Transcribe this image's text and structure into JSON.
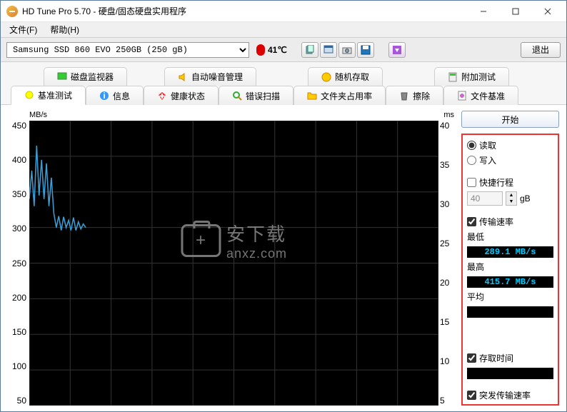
{
  "window_title": "HD Tune Pro 5.70 - 硬盘/固态硬盘实用程序",
  "menu": {
    "file": "文件(F)",
    "help": "帮助(H)"
  },
  "drive": "Samsung SSD 860 EVO 250GB (250 gB)",
  "temperature": "41℃",
  "exit_label": "退出",
  "tabs_row1": {
    "disk_monitor": "磁盘监视器",
    "auto_noise": "自动噪音管理",
    "random_access": "随机存取",
    "additional_test": "附加测试"
  },
  "tabs_row2": {
    "benchmark": "基准测试",
    "info": "信息",
    "health": "健康状态",
    "error_scan": "错误扫描",
    "folder_usage": "文件夹占用率",
    "erase": "擦除",
    "file_benchmark": "文件基准"
  },
  "start_label": "开始",
  "panel": {
    "read": "读取",
    "write": "写入",
    "quick_stroke": "快捷行程",
    "gb_value": "40",
    "gb_unit": "gB",
    "transfer_rate": "传输速率",
    "min_label": "最低",
    "min_value": " 289.1 MB/s ",
    "max_label": "最高",
    "max_value": " 415.7 MB/s ",
    "avg_label": "平均",
    "avg_value": " ",
    "access_time": "存取时间",
    "burst_rate": "突发传输速率"
  },
  "chart_data": {
    "type": "line",
    "title": "",
    "y_left_label": "MB/s",
    "y_right_label": "ms",
    "y_left_ticks": [
      450,
      400,
      350,
      300,
      250,
      200,
      150,
      100,
      50
    ],
    "y_right_ticks": [
      40,
      35,
      30,
      25,
      20,
      15,
      10,
      5
    ],
    "x_range_pct": [
      0,
      100
    ],
    "progress_pct": 14,
    "series": [
      {
        "name": "Transfer rate (read)",
        "color": "#3a9fd6",
        "axis": "left",
        "x_pct": [
          0,
          0.6,
          1.2,
          1.8,
          2.4,
          3.0,
          3.6,
          4.2,
          4.8,
          5.4,
          6.0,
          6.6,
          7.2,
          7.8,
          8.4,
          9.0,
          9.6,
          10.2,
          10.8,
          11.4,
          12.0,
          12.6,
          13.2,
          13.8
        ],
        "y_mbps": [
          340,
          380,
          330,
          415,
          345,
          395,
          340,
          390,
          330,
          370,
          320,
          300,
          316,
          296,
          315,
          300,
          310,
          296,
          314,
          296,
          308,
          298,
          305,
          300
        ]
      }
    ]
  },
  "watermark": {
    "text1": "安下载",
    "text2": "anxz.com"
  }
}
